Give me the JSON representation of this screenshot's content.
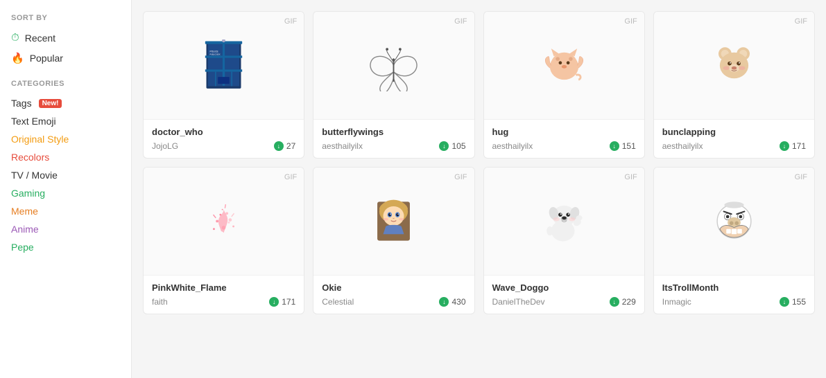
{
  "sidebar": {
    "sort_by_label": "SORT BY",
    "sort_items": [
      {
        "id": "recent",
        "label": "Recent",
        "icon": "recent-icon"
      },
      {
        "id": "popular",
        "label": "Popular",
        "icon": "fire-icon"
      }
    ],
    "categories_label": "CATEGORIES",
    "categories": [
      {
        "id": "tags",
        "label": "Tags",
        "badge": "New!",
        "class": "tags"
      },
      {
        "id": "text-emoji",
        "label": "Text Emoji",
        "badge": null,
        "class": "text-emoji"
      },
      {
        "id": "original-style",
        "label": "Original Style",
        "badge": null,
        "class": "original-style"
      },
      {
        "id": "recolors",
        "label": "Recolors",
        "badge": null,
        "class": "recolors"
      },
      {
        "id": "tv-movie",
        "label": "TV / Movie",
        "badge": null,
        "class": "tv-movie"
      },
      {
        "id": "gaming",
        "label": "Gaming",
        "badge": null,
        "class": "gaming"
      },
      {
        "id": "meme",
        "label": "Meme",
        "badge": null,
        "class": "meme"
      },
      {
        "id": "anime",
        "label": "Anime",
        "badge": null,
        "class": "anime"
      },
      {
        "id": "pepe",
        "label": "Pepe",
        "badge": null,
        "class": "pepe"
      }
    ]
  },
  "grid": {
    "gif_label": "GIF",
    "rows": [
      [
        {
          "id": "doctor_who",
          "title": "doctor_who",
          "author": "JojoLG",
          "downloads": "27",
          "icon_type": "tardis"
        },
        {
          "id": "butterflywings",
          "title": "butterflywings",
          "author": "aesthailyilx",
          "downloads": "105",
          "icon_type": "wings"
        },
        {
          "id": "hug",
          "title": "hug",
          "author": "aesthailyilx",
          "downloads": "151",
          "icon_type": "hug-cat"
        },
        {
          "id": "bunclapping",
          "title": "bunclapping",
          "author": "aesthailyilx",
          "downloads": "171",
          "icon_type": "bear"
        }
      ],
      [
        {
          "id": "pinkwhite_flame",
          "title": "PinkWhite_Flame",
          "author": "faith",
          "downloads": "171",
          "icon_type": "pink-flame"
        },
        {
          "id": "okie",
          "title": "Okie",
          "author": "Celestial",
          "downloads": "430",
          "icon_type": "anime-girl"
        },
        {
          "id": "wave_doggo",
          "title": "Wave_Doggo",
          "author": "DanielTheDev",
          "downloads": "229",
          "icon_type": "dog"
        },
        {
          "id": "itstrollmonth",
          "title": "ItsTrollMonth",
          "author": "Inmagic",
          "downloads": "155",
          "icon_type": "troll"
        }
      ]
    ]
  }
}
